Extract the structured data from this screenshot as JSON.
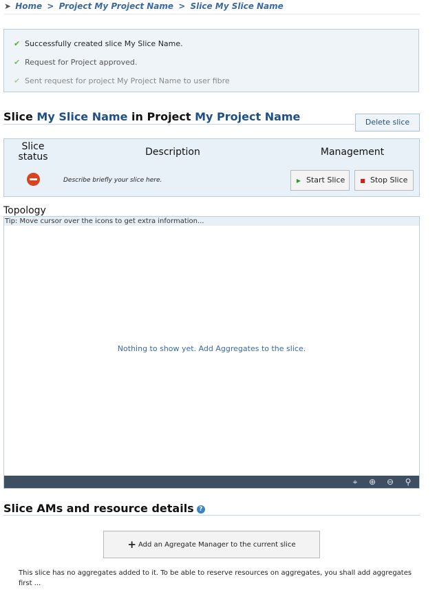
{
  "breadcrumb": {
    "home": "Home",
    "project": "Project My Project Name",
    "slice": "Slice My Slice Name",
    "separator": ">"
  },
  "messages": [
    "Successfully created slice My Slice Name.",
    "Request for Project approved.",
    "Sent request for project My Project Name to user fibre"
  ],
  "title": {
    "slice_word": "Slice",
    "slice_name": "My Slice Name",
    "in_project": "in Project",
    "project_name": "My Project Name"
  },
  "delete_button": "Delete slice",
  "slice_panel": {
    "status_header": "Slice status",
    "description_header": "Description",
    "management_header": "Management",
    "description_text": "Describe briefly your slice here.",
    "status_icon": "stop-circle-icon",
    "start_button": "Start Slice",
    "stop_button": "Stop Slice"
  },
  "topology": {
    "title": "Topology",
    "tip": "Tip: Move cursor over the icons to get extra information...",
    "empty_message": "Nothing to show yet. Add Aggregates to the slice.",
    "toolbar_icons": [
      "fit-icon",
      "zoom-in-icon",
      "zoom-out-icon",
      "search-icon"
    ]
  },
  "aggregates": {
    "title": "Slice AMs and resource details",
    "add_button": "Add an Agregate Manager to the current slice",
    "note": "This slice has no aggregates added to it. To be able to reserve resources on aggregates, you shall add aggregates first ..."
  },
  "colors": {
    "accent": "#1e4f86",
    "panel_bg": "#e8f0f8",
    "toolbar_bg": "#3e4f61",
    "success": "#57a83a",
    "status_stopped": "#d9431e"
  }
}
